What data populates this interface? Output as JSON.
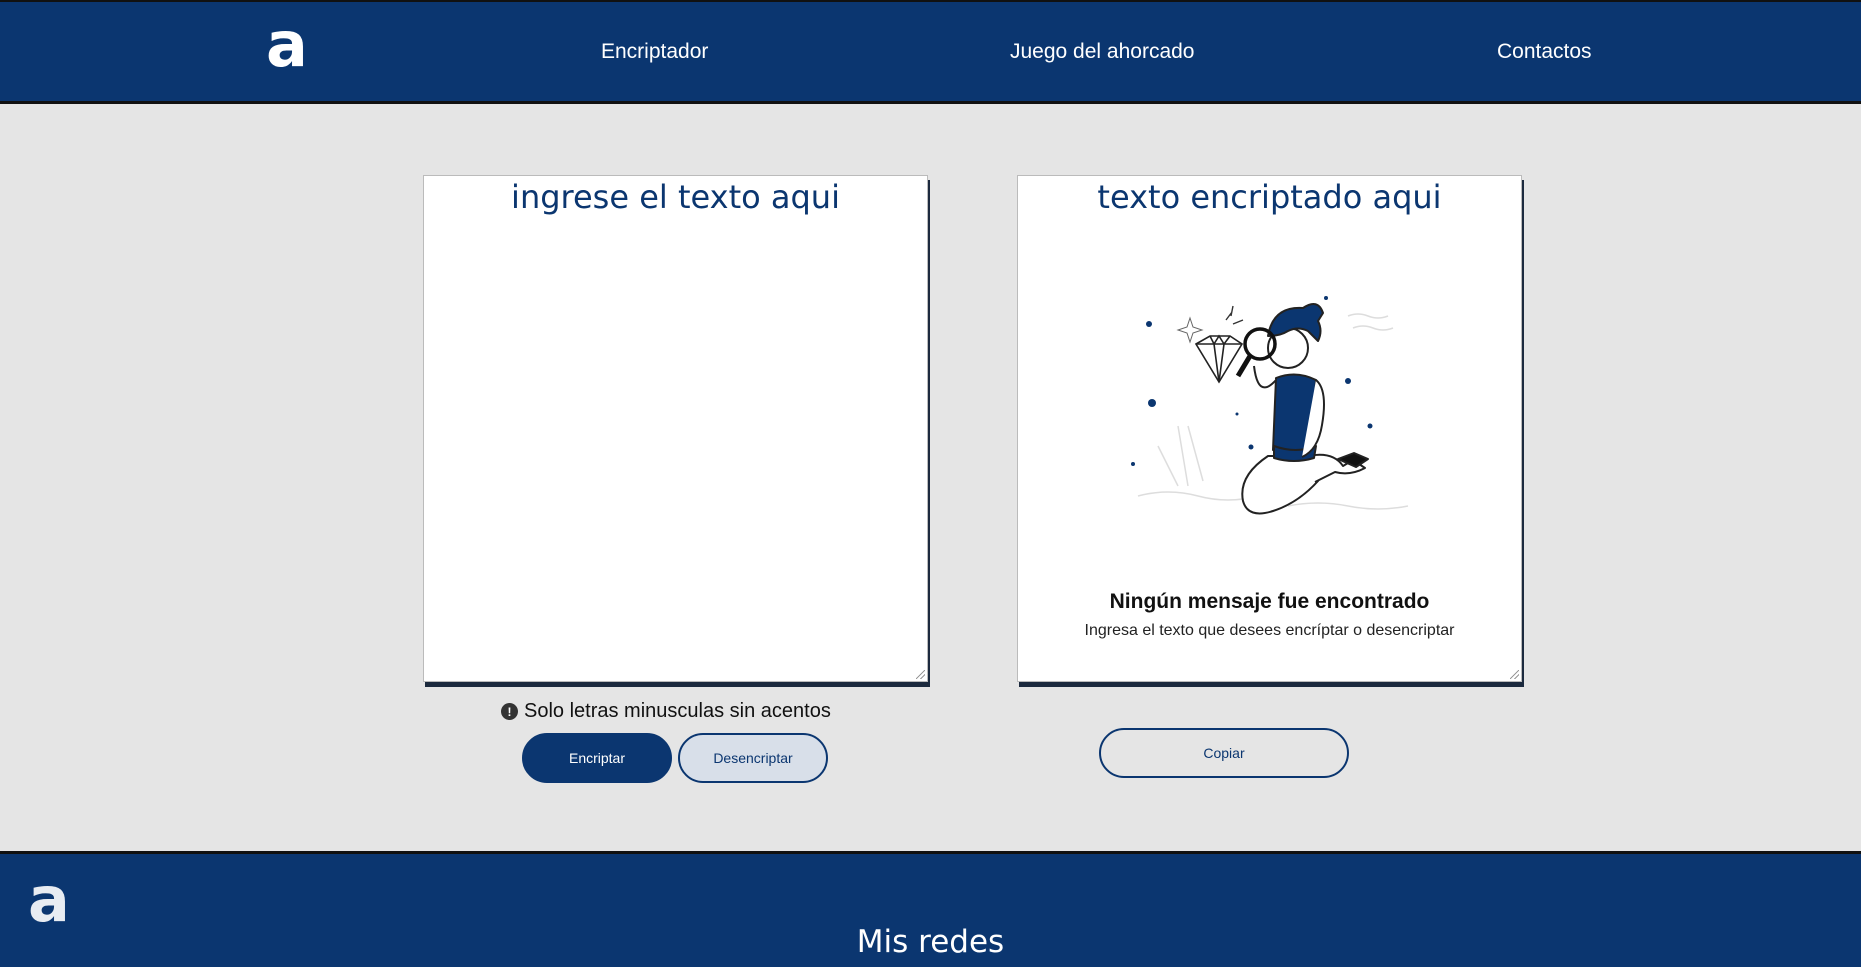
{
  "header": {
    "logo_text": "a",
    "nav": [
      {
        "label": "Encriptador"
      },
      {
        "label": "Juego del ahorcado"
      },
      {
        "label": "Contactos"
      }
    ]
  },
  "input_panel": {
    "title": "ingrese el texto aqui",
    "value": ""
  },
  "output_panel": {
    "title": "texto encriptado aqui",
    "illustration": "person-with-magnifying-glass-and-diamond",
    "empty_title": "Ningún mensaje fue encontrado",
    "empty_subtitle": "Ingresa el texto que desees encríptar o desencriptar"
  },
  "hint": {
    "icon": "exclamation-circle-icon",
    "text": "Solo letras minusculas sin acentos"
  },
  "buttons": {
    "encrypt": "Encriptar",
    "decrypt": "Desencriptar",
    "copy": "Copiar"
  },
  "footer": {
    "logo_text": "a",
    "title": "Mis redes"
  },
  "colors": {
    "primary": "#0b3670",
    "background": "#e5e5e5",
    "panel": "#ffffff"
  }
}
